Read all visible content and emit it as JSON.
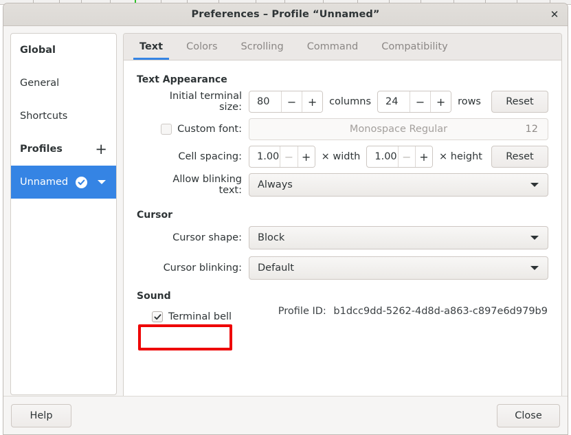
{
  "window": {
    "title": "Preferences – Profile “Unnamed”",
    "close_icon": "close-icon",
    "close_glyph": "✕"
  },
  "sidebar": {
    "rows": [
      {
        "label": "Global",
        "type": "header"
      },
      {
        "label": "General",
        "type": "item"
      },
      {
        "label": "Shortcuts",
        "type": "item"
      },
      {
        "label": "Profiles",
        "type": "header",
        "add_label": "+"
      },
      {
        "label": "Unnamed",
        "type": "item",
        "selected": true
      }
    ]
  },
  "tabs": [
    {
      "label": "Text",
      "active": true
    },
    {
      "label": "Colors",
      "active": false
    },
    {
      "label": "Scrolling",
      "active": false
    },
    {
      "label": "Command",
      "active": false
    },
    {
      "label": "Compatibility",
      "active": false
    }
  ],
  "text_tab": {
    "section_text_appearance": "Text Appearance",
    "terminal_size": {
      "label": "Initial terminal size:",
      "columns_value": "80",
      "columns_minus": "−",
      "columns_plus": "+",
      "columns_unit": "columns",
      "rows_value": "24",
      "rows_minus": "−",
      "rows_plus": "+",
      "rows_unit": "rows",
      "reset_label": "Reset"
    },
    "custom_font": {
      "label": "Custom font:",
      "checked": false,
      "font_name": "Monospace Regular",
      "font_size": "12"
    },
    "cell_spacing": {
      "label": "Cell spacing:",
      "width_value": "1.00",
      "width_minus": "−",
      "width_plus": "+",
      "width_unit": "× width",
      "height_value": "1.00",
      "height_minus": "−",
      "height_plus": "+",
      "height_unit": "× height",
      "reset_label": "Reset"
    },
    "blinking_text": {
      "label": "Allow blinking text:",
      "value": "Always"
    },
    "section_cursor": "Cursor",
    "cursor_shape": {
      "label": "Cursor shape:",
      "value": "Block"
    },
    "cursor_blinking": {
      "label": "Cursor blinking:",
      "value": "Default"
    },
    "section_sound": "Sound",
    "terminal_bell": {
      "label": "Terminal bell",
      "checked": true,
      "highlighted": true
    },
    "profile_id_label": "Profile ID:",
    "profile_id_value": "b1dcc9dd-5262-4d8d-a863-c897e6d979b9"
  },
  "footer": {
    "help_label": "Help",
    "close_label": "Close"
  },
  "colors": {
    "accent_blue": "#3584e4",
    "annotation_red": "#ee0000",
    "titlebar_bg": "#dfdcd8",
    "panel_bg": "#ffffff",
    "window_bg": "#f6f5f4"
  }
}
